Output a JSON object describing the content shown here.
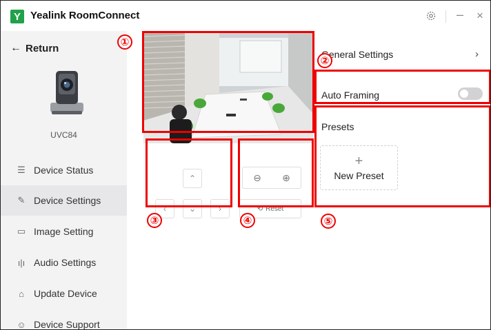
{
  "app": {
    "logo_letter": "Y",
    "title": "Yealink RoomConnect",
    "brand_color": "#21a14a"
  },
  "window": {
    "minimize": "–",
    "close": "×"
  },
  "sidebar": {
    "return_label": "Return",
    "device_model": "UVC84",
    "items": [
      {
        "label": "Device Status",
        "icon": "document-icon",
        "glyph": "☰"
      },
      {
        "label": "Device Settings",
        "icon": "wrench-icon",
        "glyph": "✎",
        "active": true
      },
      {
        "label": "Image Setting",
        "icon": "video-icon",
        "glyph": "▭"
      },
      {
        "label": "Audio Settings",
        "icon": "equalizer-icon",
        "glyph": "ı|ı"
      },
      {
        "label": "Update Device",
        "icon": "upload-icon",
        "glyph": "⌂"
      },
      {
        "label": "Device Support",
        "icon": "support-icon",
        "glyph": "☺"
      }
    ]
  },
  "controls": {
    "up": "⌃",
    "down": "⌄",
    "left": "‹",
    "right": "›",
    "zoom_out": "⊖",
    "zoom_in": "⊕",
    "reset_label": "Reset"
  },
  "settings": {
    "general_label": "General Settings",
    "auto_framing_label": "Auto Framing",
    "auto_framing_on": false,
    "presets_label": "Presets",
    "new_preset_label": "New Preset",
    "new_preset_plus": "+"
  },
  "annotations": {
    "color": "#ee0000",
    "labels": [
      "①",
      "②",
      "③",
      "④",
      "⑤"
    ]
  }
}
